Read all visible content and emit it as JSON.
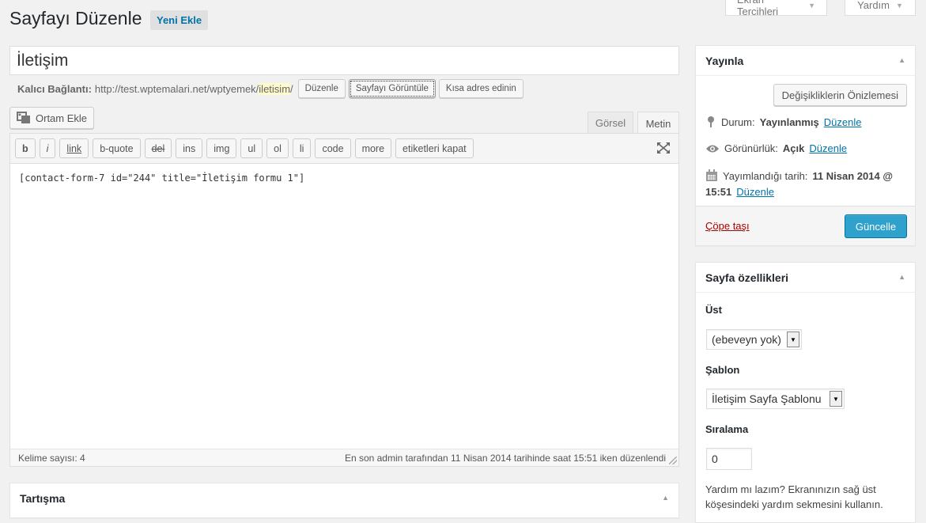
{
  "screen_meta": {
    "options_label": "Ekran Tercihleri",
    "help_label": "Yardım"
  },
  "header": {
    "title": "Sayfayı Düzenle",
    "add_new": "Yeni Ekle"
  },
  "post_title": "İletişim",
  "permalink": {
    "label": "Kalıcı Bağlantı:",
    "base": "http://test.wptemalari.net/wptyemek/",
    "slug": "iletisim",
    "trail": "/",
    "edit_btn": "Düzenle",
    "view_btn": "Sayfayı Görüntüle",
    "shortlink_btn": "Kısa adres edinin"
  },
  "editor": {
    "media_button": "Ortam Ekle",
    "tab_visual": "Görsel",
    "tab_text": "Metin",
    "quicktags": [
      "b",
      "i",
      "link",
      "b-quote",
      "del",
      "ins",
      "img",
      "ul",
      "ol",
      "li",
      "code",
      "more",
      "etiketleri kapat"
    ],
    "content": "[contact-form-7 id=\"244\" title=\"İletişim formu 1\"]",
    "word_count": "Kelime sayısı: 4",
    "last_edit": "En son admin tarafından 11 Nisan 2014 tarihinde saat 15:51 iken düzenlendi"
  },
  "discussion_box": {
    "title": "Tartışma"
  },
  "publish_box": {
    "title": "Yayınla",
    "preview_btn": "Değişikliklerin Önizlemesi",
    "status_label": "Durum:",
    "status_value": "Yayınlanmış",
    "visibility_label": "Görünürlük:",
    "visibility_value": "Açık",
    "published_label": "Yayımlandığı tarih:",
    "published_value_1": "11 Nisan 2014 @",
    "published_value_2": "15:51",
    "edit_link": "Düzenle",
    "trash_link": "Çöpe taşı",
    "update_btn": "Güncelle"
  },
  "page_attributes": {
    "title": "Sayfa özellikleri",
    "parent_label": "Üst",
    "parent_value": "(ebeveyn yok)",
    "template_label": "Şablon",
    "template_value": "İletişim Sayfa Şablonu",
    "order_label": "Sıralama",
    "order_value": "0",
    "help_text_1": "Yardım mı lazım? Ekranınızın sağ üst",
    "help_text_2": "köşesindeki yardım sekmesini kullanın."
  },
  "colors": {
    "link": "#0073aa",
    "primary_button": "#2ea2cc",
    "trash": "#a00",
    "slug_highlight": "#fffbcc"
  }
}
